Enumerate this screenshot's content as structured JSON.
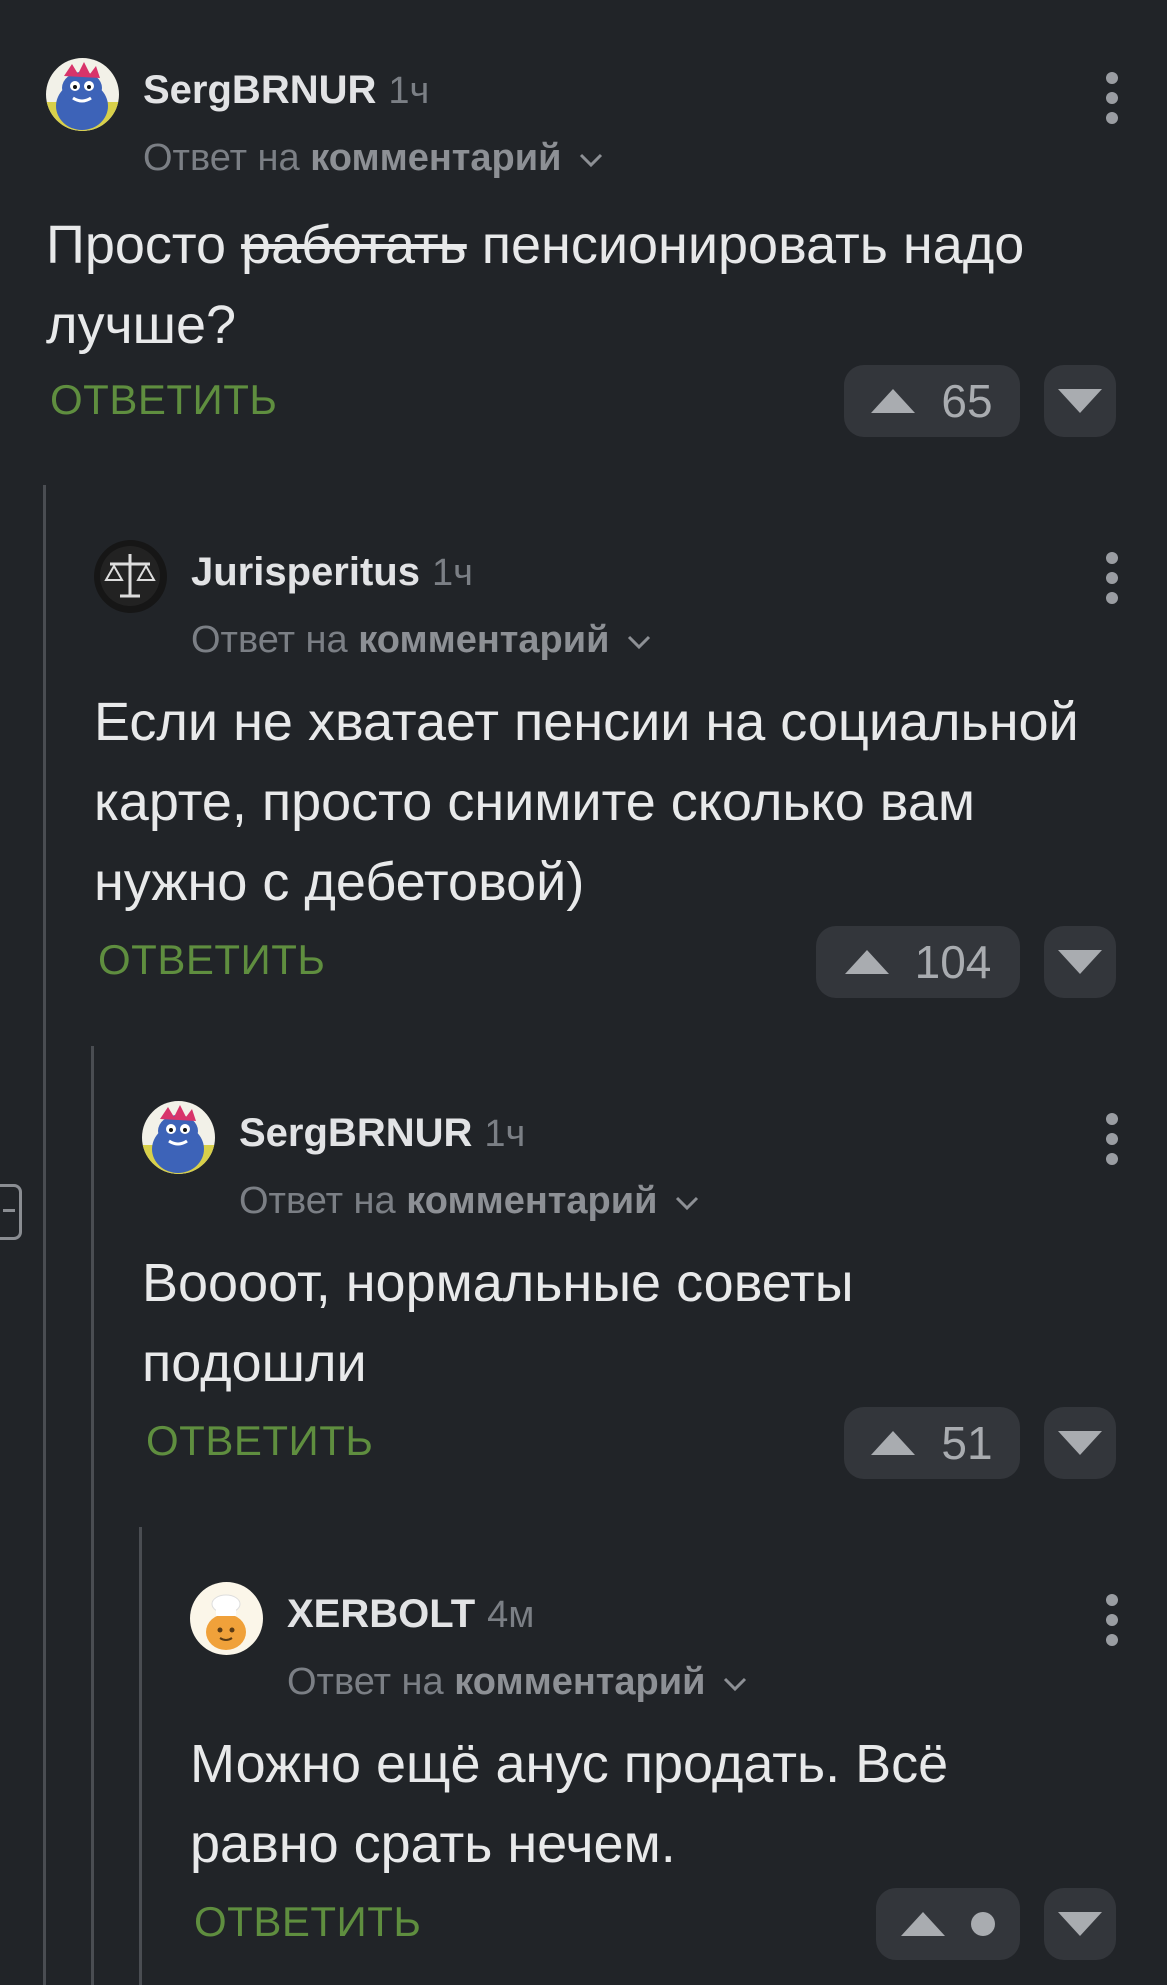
{
  "comments": [
    {
      "author": "SergBRNUR",
      "time": "1ч",
      "reply_prefix": "Ответ на",
      "reply_target": "комментарий",
      "text_before": "Просто ",
      "text_struck": "работать",
      "text_after": " пенсионировать надо лучше?",
      "reply_label": "ОТВЕТИТЬ",
      "rating": "65",
      "avatar_icon": "monster-avatar-icon"
    },
    {
      "author": "Jurisperitus",
      "time": "1ч",
      "reply_prefix": "Ответ на",
      "reply_target": "комментарий",
      "text": "Если не хватает пенсии на социальной карте, просто снимите сколько вам нужно с дебетовой)",
      "reply_label": "ОТВЕТИТЬ",
      "rating": "104",
      "avatar_icon": "scales-avatar-icon"
    },
    {
      "author": "SergBRNUR",
      "time": "1ч",
      "reply_prefix": "Ответ на",
      "reply_target": "комментарий",
      "text": "Воооот, нормальные советы подошли",
      "reply_label": "ОТВЕТИТЬ",
      "rating": "51",
      "avatar_icon": "monster-avatar-icon"
    },
    {
      "author": "XERBOLT",
      "time": "4м",
      "reply_prefix": "Ответ на",
      "reply_target": "комментарий",
      "text": "Можно ещё анус продать. Всё равно срать нечем.",
      "reply_label": "ОТВЕТИТЬ",
      "rating_hidden": true,
      "avatar_icon": "chef-avatar-icon"
    }
  ],
  "colors": {
    "background": "#212428",
    "reply_link": "#5f8e3f",
    "vote_button": "#33363b",
    "muted_text": "#7b7f85"
  }
}
